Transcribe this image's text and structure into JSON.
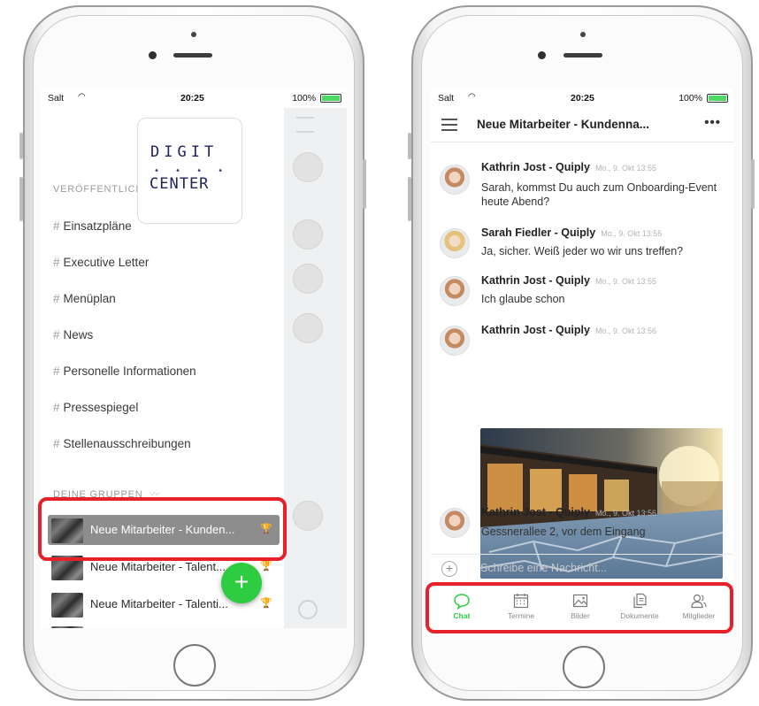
{
  "left_phone": {
    "status": {
      "carrier": "Salt",
      "time": "20:25",
      "battery": "100%"
    },
    "logo": {
      "line1": "DIGIT",
      "dots": "• • • •",
      "line2": "CENTER"
    },
    "section_public": "VERÖFFENTLICHT",
    "channels": [
      {
        "label": "Einsatzpläne"
      },
      {
        "label": "Executive Letter"
      },
      {
        "label": "Menüplan"
      },
      {
        "label": "News"
      },
      {
        "label": "Personelle Informationen"
      },
      {
        "label": "Pressespiegel"
      },
      {
        "label": "Stellenausschreibungen"
      }
    ],
    "section_groups": "DEINE GRUPPEN",
    "groups": [
      {
        "label": "Neue Mitarbeiter - Kunden...",
        "active": true
      },
      {
        "label": "Neue Mitarbeiter - Talent..."
      },
      {
        "label": "Neue Mitarbeiter - Talenti..."
      }
    ],
    "fab_label": "+"
  },
  "right_phone": {
    "status": {
      "carrier": "Salt",
      "time": "20:25",
      "battery": "100%"
    },
    "title": "Neue Mitarbeiter - Kundenna...",
    "more": "•••",
    "messages": [
      {
        "author": "Kathrin Jost - Quiply",
        "time": "Mo., 9. Okt 13:55",
        "text": "Sarah, kommst Du auch zum Onboarding-Event heute Abend?"
      },
      {
        "author": "Sarah Fiedler - Quiply",
        "time": "Mo., 9. Okt 13:55",
        "text": "Ja, sicher. Weiß jeder wo wir uns treffen?"
      },
      {
        "author": "Kathrin Jost - Quiply",
        "time": "Mo., 9. Okt 13:55",
        "text": "Ich glaube schon"
      },
      {
        "author": "Kathrin Jost - Quiply",
        "time": "Mo., 9. Okt 13:56",
        "text": ""
      },
      {
        "author": "Kathrin Jost - Quiply",
        "time": "Mo., 9. Okt 13:56",
        "text": "Gessnerallee 2, vor dem Eingang"
      }
    ],
    "composer_placeholder": "Schreibe eine Nachricht...",
    "tabs": [
      {
        "label": "Chat",
        "icon": "chat-bubble-icon"
      },
      {
        "label": "Termine",
        "icon": "calendar-icon"
      },
      {
        "label": "Bilder",
        "icon": "image-icon"
      },
      {
        "label": "Dokumente",
        "icon": "documents-icon"
      },
      {
        "label": "Mitglieder",
        "icon": "members-icon"
      }
    ]
  },
  "colors": {
    "accent_green": "#2ecc40",
    "highlight_red": "#e8202a",
    "active_row": "#8d8d8d"
  }
}
